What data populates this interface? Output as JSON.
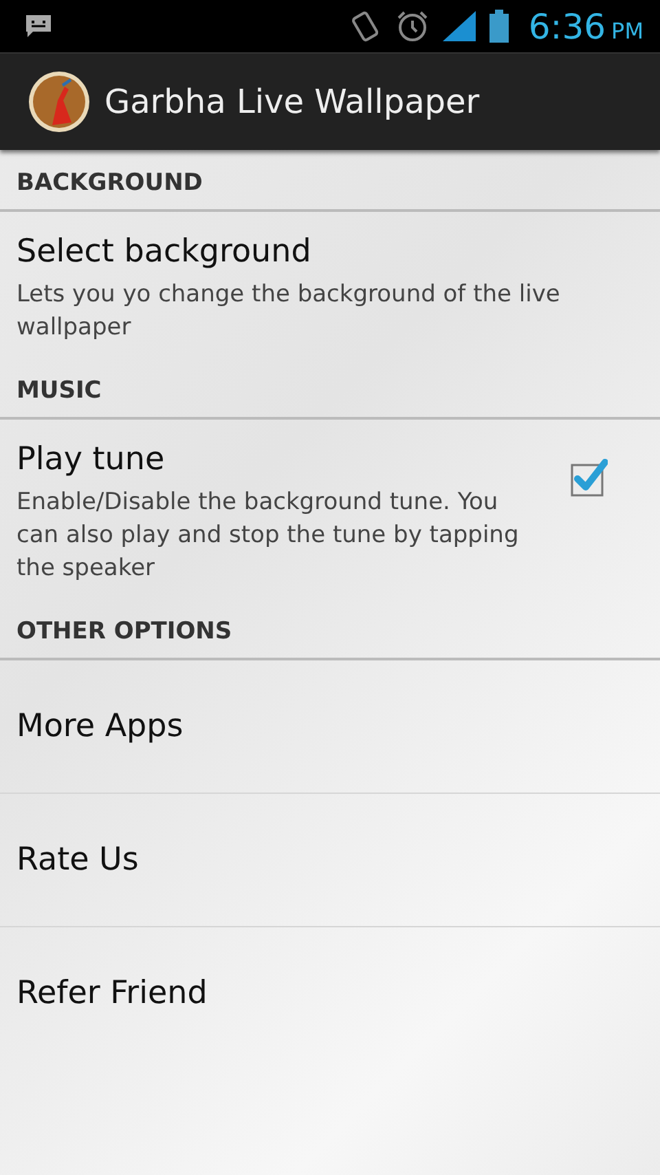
{
  "status_bar": {
    "time": "6:36",
    "period": "PM"
  },
  "app_bar": {
    "title": "Garbha Live Wallpaper"
  },
  "sections": [
    {
      "header": "BACKGROUND",
      "items": [
        {
          "kind": "text",
          "title": "Select background",
          "summary": "Lets you yo change the background of the live wallpaper"
        }
      ]
    },
    {
      "header": "MUSIC",
      "items": [
        {
          "kind": "checkbox",
          "title": "Play tune",
          "summary": "Enable/Disable the background tune. You can also play and stop the tune by tapping the speaker",
          "checked": true
        }
      ]
    },
    {
      "header": "OTHER OPTIONS",
      "items": [
        {
          "kind": "link",
          "title": "More Apps"
        },
        {
          "kind": "link",
          "title": "Rate Us"
        },
        {
          "kind": "link",
          "title": "Refer Friend"
        }
      ]
    }
  ]
}
